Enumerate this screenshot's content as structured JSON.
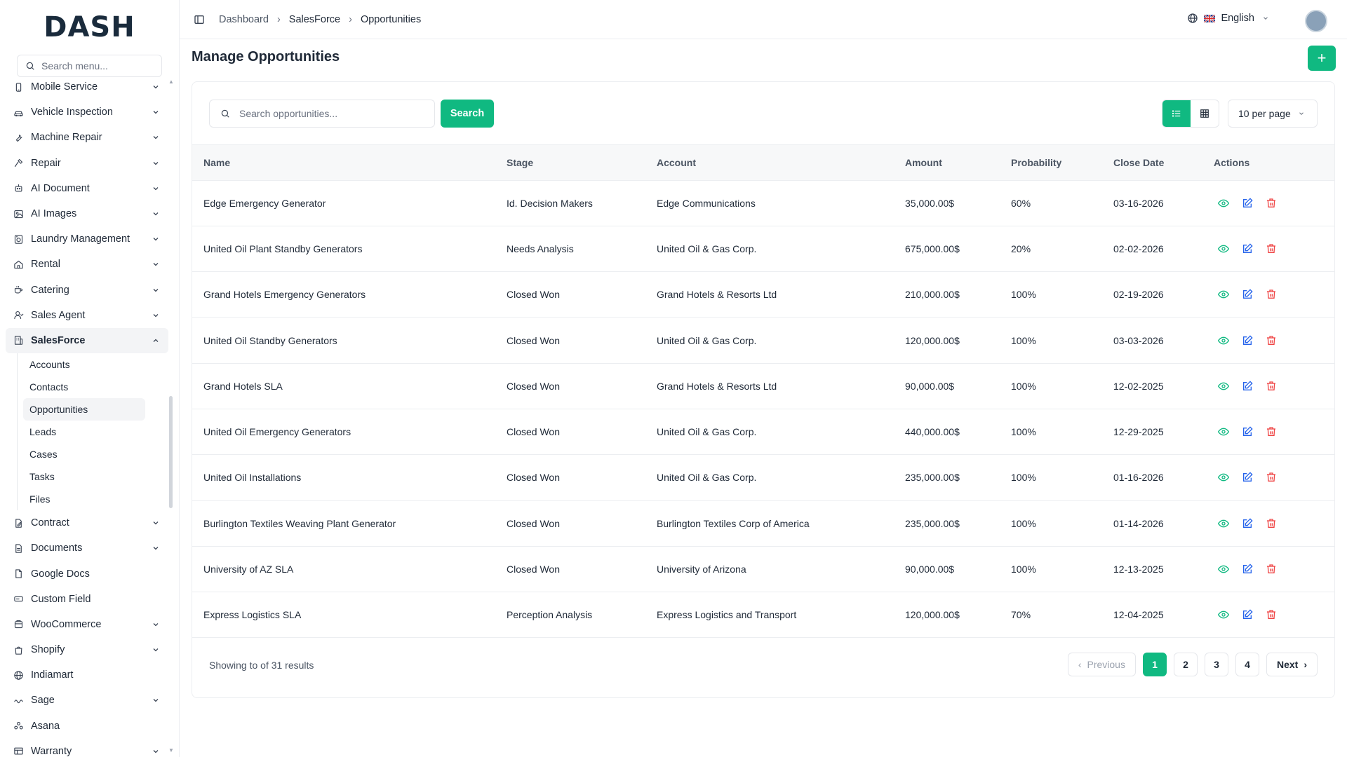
{
  "brand": {
    "logo_text": "DASH"
  },
  "sidebar": {
    "search_placeholder": "Search menu...",
    "items": [
      {
        "label": "Mobile Service",
        "icon": "phone-icon",
        "chevron": true
      },
      {
        "label": "Vehicle Inspection",
        "icon": "car-icon",
        "chevron": true
      },
      {
        "label": "Machine Repair",
        "icon": "wrench-icon",
        "chevron": true
      },
      {
        "label": "Repair",
        "icon": "hammer-icon",
        "chevron": true
      },
      {
        "label": "AI Document",
        "icon": "robot-icon",
        "chevron": true
      },
      {
        "label": "AI Images",
        "icon": "image-icon",
        "chevron": true
      },
      {
        "label": "Laundry Management",
        "icon": "washer-icon",
        "chevron": true
      },
      {
        "label": "Rental",
        "icon": "home-icon",
        "chevron": true
      },
      {
        "label": "Catering",
        "icon": "coffee-icon",
        "chevron": true
      },
      {
        "label": "Sales Agent",
        "icon": "user-icon",
        "chevron": true
      },
      {
        "label": "SalesForce",
        "icon": "building-icon",
        "chevron": true,
        "active": true
      }
    ],
    "sub_items": [
      {
        "label": "Accounts"
      },
      {
        "label": "Contacts"
      },
      {
        "label": "Opportunities",
        "active": true
      },
      {
        "label": "Leads"
      },
      {
        "label": "Cases"
      },
      {
        "label": "Tasks"
      },
      {
        "label": "Files"
      }
    ],
    "items_after": [
      {
        "label": "Contract",
        "icon": "contract-icon",
        "chevron": true
      },
      {
        "label": "Documents",
        "icon": "document-icon",
        "chevron": true
      },
      {
        "label": "Google Docs",
        "icon": "google-docs-icon",
        "chevron": false
      },
      {
        "label": "Custom Field",
        "icon": "field-icon",
        "chevron": false
      },
      {
        "label": "WooCommerce",
        "icon": "cart-icon",
        "chevron": true
      },
      {
        "label": "Shopify",
        "icon": "shopping-bag-icon",
        "chevron": true
      },
      {
        "label": "Indiamart",
        "icon": "globe-icon",
        "chevron": false
      },
      {
        "label": "Sage",
        "icon": "sage-icon",
        "chevron": true
      },
      {
        "label": "Asana",
        "icon": "asana-icon",
        "chevron": false
      },
      {
        "label": "Warranty",
        "icon": "warranty-icon",
        "chevron": true
      }
    ]
  },
  "header": {
    "breadcrumbs": [
      "Dashboard",
      "SalesForce",
      "Opportunities"
    ],
    "language": "English"
  },
  "page": {
    "title": "Manage Opportunities",
    "add_label": "+"
  },
  "toolbar": {
    "search_placeholder": "Search opportunities...",
    "search_label": "Search",
    "per_page": "10 per page"
  },
  "table": {
    "columns": [
      "Name",
      "Stage",
      "Account",
      "Amount",
      "Probability",
      "Close Date",
      "Actions"
    ],
    "rows": [
      [
        "Edge Emergency Generator",
        "Id. Decision Makers",
        "Edge Communications",
        "35,000.00$",
        "60%",
        "03-16-2026"
      ],
      [
        "United Oil Plant Standby Generators",
        "Needs Analysis",
        "United Oil & Gas Corp.",
        "675,000.00$",
        "20%",
        "02-02-2026"
      ],
      [
        "Grand Hotels Emergency Generators",
        "Closed Won",
        "Grand Hotels & Resorts Ltd",
        "210,000.00$",
        "100%",
        "02-19-2026"
      ],
      [
        "United Oil Standby Generators",
        "Closed Won",
        "United Oil & Gas Corp.",
        "120,000.00$",
        "100%",
        "03-03-2026"
      ],
      [
        "Grand Hotels SLA",
        "Closed Won",
        "Grand Hotels & Resorts Ltd",
        "90,000.00$",
        "100%",
        "12-02-2025"
      ],
      [
        "United Oil Emergency Generators",
        "Closed Won",
        "United Oil & Gas Corp.",
        "440,000.00$",
        "100%",
        "12-29-2025"
      ],
      [
        "United Oil Installations",
        "Closed Won",
        "United Oil & Gas Corp.",
        "235,000.00$",
        "100%",
        "01-16-2026"
      ],
      [
        "Burlington Textiles Weaving Plant Generator",
        "Closed Won",
        "Burlington Textiles Corp of America",
        "235,000.00$",
        "100%",
        "01-14-2026"
      ],
      [
        "University of AZ SLA",
        "Closed Won",
        "University of Arizona",
        "90,000.00$",
        "100%",
        "12-13-2025"
      ],
      [
        "Express Logistics SLA",
        "Perception Analysis",
        "Express Logistics and Transport",
        "120,000.00$",
        "70%",
        "12-04-2025"
      ]
    ]
  },
  "footer": {
    "showing": "Showing to of 31 results",
    "previous": "Previous",
    "next": "Next",
    "pages": [
      "1",
      "2",
      "3",
      "4"
    ],
    "current_page": "1"
  },
  "colors": {
    "accent": "#10b981",
    "danger": "#ef4444",
    "link": "#2563eb"
  }
}
